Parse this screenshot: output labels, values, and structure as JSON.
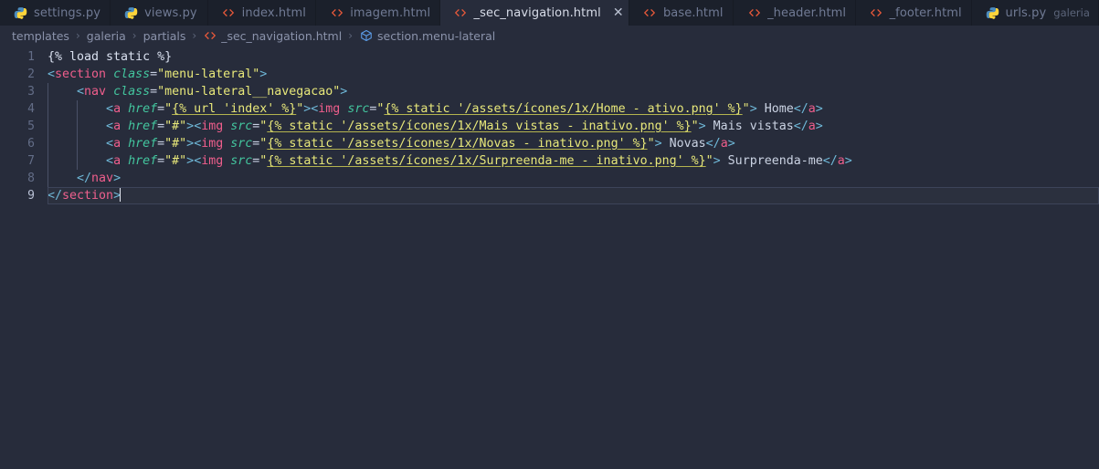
{
  "tabbar": {
    "tabs": [
      {
        "label": "settings.py",
        "icon": "python-icon",
        "desc": "",
        "active": false,
        "closable": false
      },
      {
        "label": "views.py",
        "icon": "python-icon",
        "desc": "",
        "active": false,
        "closable": false
      },
      {
        "label": "index.html",
        "icon": "html-icon",
        "desc": "",
        "active": false,
        "closable": false
      },
      {
        "label": "imagem.html",
        "icon": "html-icon",
        "desc": "",
        "active": false,
        "closable": false
      },
      {
        "label": "_sec_navigation.html",
        "icon": "html-icon",
        "desc": "",
        "active": true,
        "closable": true,
        "close_label": "✕"
      },
      {
        "label": "base.html",
        "icon": "html-icon",
        "desc": "",
        "active": false,
        "closable": false
      },
      {
        "label": "_header.html",
        "icon": "html-icon",
        "desc": "",
        "active": false,
        "closable": false
      },
      {
        "label": "_footer.html",
        "icon": "html-icon",
        "desc": "",
        "active": false,
        "closable": false
      },
      {
        "label": "urls.py",
        "icon": "python-icon",
        "desc": "galeria",
        "active": false,
        "closable": false
      }
    ]
  },
  "breadcrumb": {
    "separator": "›",
    "items": [
      {
        "label": "templates",
        "icon": ""
      },
      {
        "label": "galeria",
        "icon": ""
      },
      {
        "label": "partials",
        "icon": ""
      },
      {
        "label": "_sec_navigation.html",
        "icon": "html-icon"
      },
      {
        "label": "section.menu-lateral",
        "icon": "symbol-namespace-icon"
      }
    ]
  },
  "editor": {
    "lines": [
      {
        "n": "1"
      },
      {
        "n": "2"
      },
      {
        "n": "3"
      },
      {
        "n": "4"
      },
      {
        "n": "5"
      },
      {
        "n": "6"
      },
      {
        "n": "7"
      },
      {
        "n": "8"
      },
      {
        "n": "9"
      }
    ],
    "code": {
      "l1": {
        "djangotag": "{% load static %}"
      },
      "l2": {
        "lt": "<",
        "tag": "section",
        "attr": "class",
        "eq": "=",
        "val": "\"menu-lateral\"",
        "gt": ">"
      },
      "l3": {
        "lt": "<",
        "tag": "nav",
        "attr": "class",
        "eq": "=",
        "val": "\"menu-lateral__navegacao\"",
        "gt": ">"
      },
      "l4": {
        "lt": "<",
        "tag": "a",
        "attr": "href",
        "eq": "=",
        "q1": "\"",
        "tpl1": "{% url 'index' %}",
        "q2": "\"",
        "gt1": ">",
        "lt2": "<",
        "tag2": "img",
        "attr2": "src",
        "eq2": "=",
        "q3": "\"",
        "tpl2": "{% static '/assets/ícones/1x/Home - ativo.png' %}",
        "q4": "\"",
        "gt2": ">",
        "text": " Home",
        "close": "</",
        "ctag": "a",
        "cgt": ">"
      },
      "l5": {
        "lt": "<",
        "tag": "a",
        "attr": "href",
        "eq": "=",
        "val": "\"#\"",
        "gt1": ">",
        "lt2": "<",
        "tag2": "img",
        "attr2": "src",
        "eq2": "=",
        "q3": "\"",
        "tpl2": "{% static '/assets/ícones/1x/Mais vistas - inativo.png' %}",
        "q4": "\"",
        "gt2": ">",
        "text": " Mais vistas",
        "close": "</",
        "ctag": "a",
        "cgt": ">"
      },
      "l6": {
        "lt": "<",
        "tag": "a",
        "attr": "href",
        "eq": "=",
        "val": "\"#\"",
        "gt1": ">",
        "lt2": "<",
        "tag2": "img",
        "attr2": "src",
        "eq2": "=",
        "q3": "\"",
        "tpl2": "{% static '/assets/ícones/1x/Novas - inativo.png' %}",
        "q4": "\"",
        "gt2": ">",
        "text": " Novas",
        "close": "</",
        "ctag": "a",
        "cgt": ">"
      },
      "l7": {
        "lt": "<",
        "tag": "a",
        "attr": "href",
        "eq": "=",
        "val": "\"#\"",
        "gt1": ">",
        "lt2": "<",
        "tag2": "img",
        "attr2": "src",
        "eq2": "=",
        "q3": "\"",
        "tpl2": "{% static '/assets/ícones/1x/Surpreenda-me - inativo.png' %}",
        "q4": "\"",
        "gt2": ">",
        "text": " Surpreenda-me",
        "close": "</",
        "ctag": "a",
        "cgt": ">"
      },
      "l8": {
        "close": "</",
        "ctag": "nav",
        "cgt": ">"
      },
      "l9": {
        "close": "</",
        "ctag": "section",
        "cgt": ">"
      }
    }
  },
  "colors": {
    "tabbar_bg": "#1b202b",
    "tab_active_bg": "#272c3b",
    "editor_bg": "#272c3b",
    "html_icon": "#e8593a",
    "python_icon": "#4b8bbe",
    "symbol_icon": "#5c9de8",
    "string": "#e8e87a",
    "tag": "#ef5e8c",
    "attr": "#43c59e",
    "punct": "#6fb8d8",
    "text": "#cbd3e3"
  }
}
